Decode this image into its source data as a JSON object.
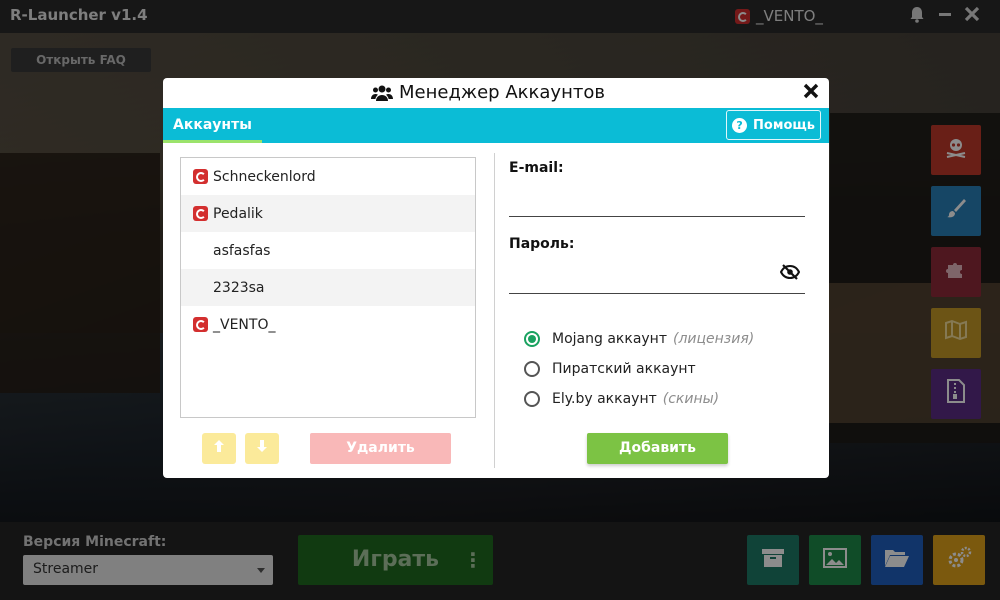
{
  "app": {
    "title": "R-Launcher v1.4",
    "user": "_VENTO_"
  },
  "faq": {
    "label": "Открыть FAQ"
  },
  "bottom": {
    "version_label": "Версия Minecraft:",
    "version_value": "Streamer",
    "play_label": "Играть",
    "play_menu": "⋮"
  },
  "side_tools": [
    {
      "icon": "skull-icon",
      "color": "#c0392b"
    },
    {
      "icon": "brush-icon",
      "color": "#2980b9"
    },
    {
      "icon": "puzzle-icon",
      "color": "#8e2a3a"
    },
    {
      "icon": "map-icon",
      "color": "#c59a27"
    },
    {
      "icon": "archive-file-icon",
      "color": "#5b2c86"
    }
  ],
  "bottom_tools": [
    {
      "icon": "archive-icon",
      "color": "#1e7a66"
    },
    {
      "icon": "image-icon",
      "color": "#1e8a4a"
    },
    {
      "icon": "folder-open-icon",
      "color": "#1f5fbf"
    },
    {
      "icon": "gears-icon",
      "color": "#e0a21b"
    }
  ],
  "modal": {
    "title": "Менеджер Аккаунтов",
    "tab": "Аккаунты",
    "help": "Помощь",
    "accounts": [
      {
        "name": "Schneckenlord",
        "licensed": true
      },
      {
        "name": "Pedalik",
        "licensed": true
      },
      {
        "name": "asfasfas",
        "licensed": false
      },
      {
        "name": "2323sa",
        "licensed": false
      },
      {
        "name": "_VENTO_",
        "licensed": true
      }
    ],
    "up_label": "🡑",
    "down_label": "🡓",
    "delete_label": "Удалить",
    "email_label": "E-mail:",
    "password_label": "Пароль:",
    "email_value": "",
    "password_value": "",
    "account_types": [
      {
        "label": "Mojang аккаунт",
        "hint": "(лицензия)",
        "selected": true
      },
      {
        "label": "Пиратский аккаунт",
        "hint": "",
        "selected": false
      },
      {
        "label": "Ely.by аккаунт",
        "hint": "(скины)",
        "selected": false
      }
    ],
    "add_label": "Добавить",
    "accent_color": "#0bbcd6"
  }
}
